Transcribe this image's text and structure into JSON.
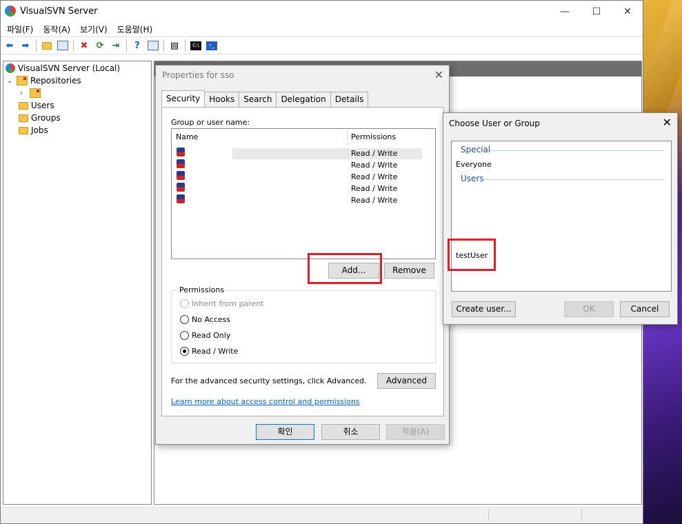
{
  "main_window": {
    "title": "VisualSVN Server",
    "controls": {
      "minimize": "—",
      "maximize": "☐",
      "close": "✕"
    },
    "menu": [
      "파일(F)",
      "동작(A)",
      "보기(V)",
      "도움말(H)"
    ],
    "toolbar_icons": [
      "back-arrow-icon",
      "forward-arrow-icon",
      "folder-up-icon",
      "show-hide-tree-icon",
      "delete-icon",
      "refresh-icon",
      "export-icon",
      "help-icon",
      "console-view-icon",
      "properties-icon",
      "command-prompt-icon",
      "powershell-icon"
    ]
  },
  "tree": {
    "root": "VisualSVN Server (Local)",
    "repositories": "Repositories",
    "users": "Users",
    "groups": "Groups",
    "jobs": "Jobs"
  },
  "properties_dialog": {
    "title": "Properties for sso",
    "close": "✕",
    "tabs": [
      "Security",
      "Hooks",
      "Search",
      "Delegation",
      "Details"
    ],
    "group_label": "Group or user name:",
    "columns": {
      "name": "Name",
      "permissions": "Permissions"
    },
    "rows": [
      {
        "name": "",
        "permission": "Read / Write"
      },
      {
        "name": "",
        "permission": "Read / Write"
      },
      {
        "name": "",
        "permission": "Read / Write"
      },
      {
        "name": "",
        "permission": "Read / Write"
      },
      {
        "name": "",
        "permission": "Read / Write"
      }
    ],
    "add_button": "Add...",
    "remove_button": "Remove",
    "permissions_title": "Permissions",
    "options": {
      "inherit": "Inherit from parent",
      "no_access": "No Access",
      "read_only": "Read Only",
      "read_write": "Read / Write"
    },
    "selected_option": "read_write",
    "advanced_text": "For the advanced security settings, click Advanced.",
    "advanced_button": "Advanced",
    "learn_more": "Learn more about access control and permissions",
    "ok": "확인",
    "cancel": "취소",
    "apply": "적용(A)"
  },
  "choose_dialog": {
    "title": "Choose User or Group",
    "close": "✕",
    "special_header": "Special",
    "everyone": "Everyone",
    "users_header": "Users",
    "test_user": "testUser",
    "create_user": "Create user...",
    "ok": "OK",
    "cancel": "Cancel"
  },
  "colors": {
    "highlight": "#e01e2a",
    "link": "#0066cc",
    "group_header": "#1e50a2"
  }
}
